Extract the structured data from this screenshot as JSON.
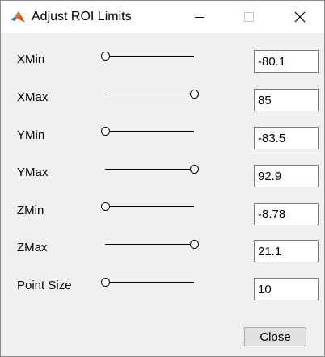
{
  "window": {
    "title": "Adjust ROI Limits",
    "app_icon": "matlab-icon"
  },
  "title_controls": {
    "minimize_icon": "minimize-icon",
    "maximize_icon": "maximize-icon",
    "close_icon": "close-icon"
  },
  "rows": [
    {
      "label": "XMin",
      "slider_fraction": 0.0,
      "value": "-80.1"
    },
    {
      "label": "XMax",
      "slider_fraction": 1.0,
      "value": "85"
    },
    {
      "label": "YMin",
      "slider_fraction": 0.0,
      "value": "-83.5"
    },
    {
      "label": "YMax",
      "slider_fraction": 1.0,
      "value": "92.9"
    },
    {
      "label": "ZMin",
      "slider_fraction": 0.0,
      "value": "-8.78"
    },
    {
      "label": "ZMax",
      "slider_fraction": 1.0,
      "value": "21.1"
    },
    {
      "label": "Point Size",
      "slider_fraction": 0.0,
      "value": "10"
    }
  ],
  "close_button": {
    "label": "Close"
  },
  "colors": {
    "window_background": "#f0f0f0",
    "titlebar_background": "#ffffff"
  }
}
